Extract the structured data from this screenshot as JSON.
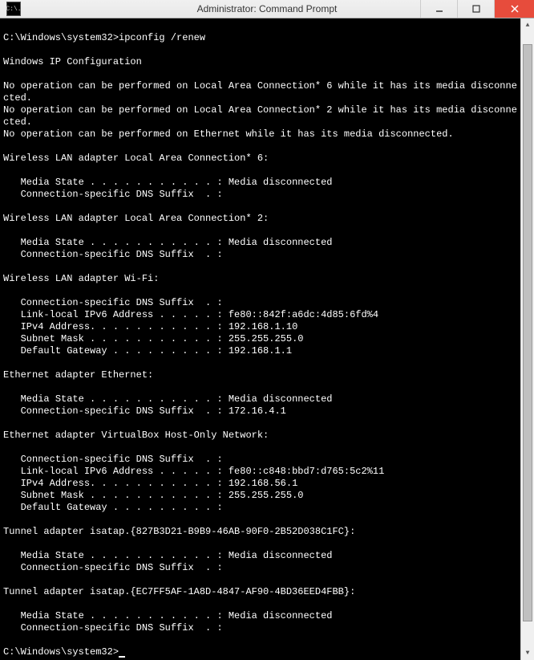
{
  "window": {
    "icon_label": "C:\\.",
    "title": "Administrator: Command Prompt"
  },
  "scrollbar": {
    "thumb_top_pct": 2,
    "thumb_height_pct": 94
  },
  "terminal": {
    "lines": [
      "",
      "C:\\Windows\\system32>ipconfig /renew",
      "",
      "Windows IP Configuration",
      "",
      "No operation can be performed on Local Area Connection* 6 while it has its media disconnected.",
      "No operation can be performed on Local Area Connection* 2 while it has its media disconnected.",
      "No operation can be performed on Ethernet while it has its media disconnected.",
      "",
      "Wireless LAN adapter Local Area Connection* 6:",
      "",
      "   Media State . . . . . . . . . . . : Media disconnected",
      "   Connection-specific DNS Suffix  . :",
      "",
      "Wireless LAN adapter Local Area Connection* 2:",
      "",
      "   Media State . . . . . . . . . . . : Media disconnected",
      "   Connection-specific DNS Suffix  . :",
      "",
      "Wireless LAN adapter Wi-Fi:",
      "",
      "   Connection-specific DNS Suffix  . :",
      "   Link-local IPv6 Address . . . . . : fe80::842f:a6dc:4d85:6fd%4",
      "   IPv4 Address. . . . . . . . . . . : 192.168.1.10",
      "   Subnet Mask . . . . . . . . . . . : 255.255.255.0",
      "   Default Gateway . . . . . . . . . : 192.168.1.1",
      "",
      "Ethernet adapter Ethernet:",
      "",
      "   Media State . . . . . . . . . . . : Media disconnected",
      "   Connection-specific DNS Suffix  . : 172.16.4.1",
      "",
      "Ethernet adapter VirtualBox Host-Only Network:",
      "",
      "   Connection-specific DNS Suffix  . :",
      "   Link-local IPv6 Address . . . . . : fe80::c848:bbd7:d765:5c2%11",
      "   IPv4 Address. . . . . . . . . . . : 192.168.56.1",
      "   Subnet Mask . . . . . . . . . . . : 255.255.255.0",
      "   Default Gateway . . . . . . . . . :",
      "",
      "Tunnel adapter isatap.{827B3D21-B9B9-46AB-90F0-2B52D038C1FC}:",
      "",
      "   Media State . . . . . . . . . . . : Media disconnected",
      "   Connection-specific DNS Suffix  . :",
      "",
      "Tunnel adapter isatap.{EC7FF5AF-1A8D-4847-AF90-4BD36EED4FBB}:",
      "",
      "   Media State . . . . . . . . . . . : Media disconnected",
      "   Connection-specific DNS Suffix  . :",
      "",
      "C:\\Windows\\system32>"
    ]
  }
}
